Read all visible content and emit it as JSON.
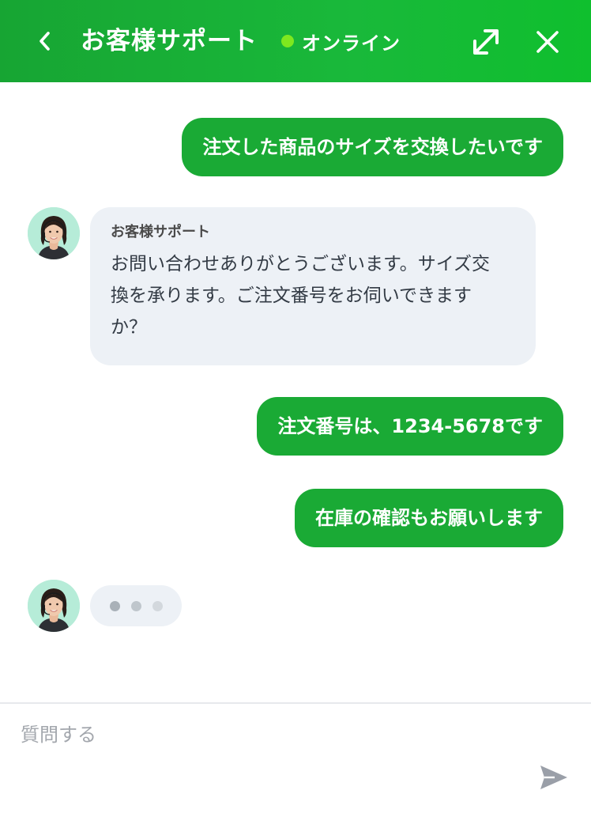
{
  "header": {
    "back_icon": "chevron-left-icon",
    "title": "お客様サポート",
    "status_label": "オンライン",
    "status_color": "#7ee81f",
    "expand_icon": "expand-arrows-icon",
    "close_icon": "close-icon",
    "brand_color": "#17a533"
  },
  "messages": [
    {
      "type": "user",
      "text": "注文した商品のサイズを交換したいです"
    },
    {
      "type": "agent",
      "name": "お客様サポート",
      "text": "お問い合わせありがとうございます。サイズ交換を承ります。ご注文番号をお伺いできますか？"
    },
    {
      "type": "user",
      "text": "注文番号は、1234-5678です"
    },
    {
      "type": "user",
      "text": "在庫の確認もお願いします"
    }
  ],
  "typing_indicator": {
    "avatar_icon": "support-agent-avatar",
    "dot_colors": [
      "#a9b1b8",
      "#bfc6cc",
      "#d3d8dd"
    ]
  },
  "composer": {
    "placeholder": "質問する",
    "send_icon": "send-icon"
  }
}
